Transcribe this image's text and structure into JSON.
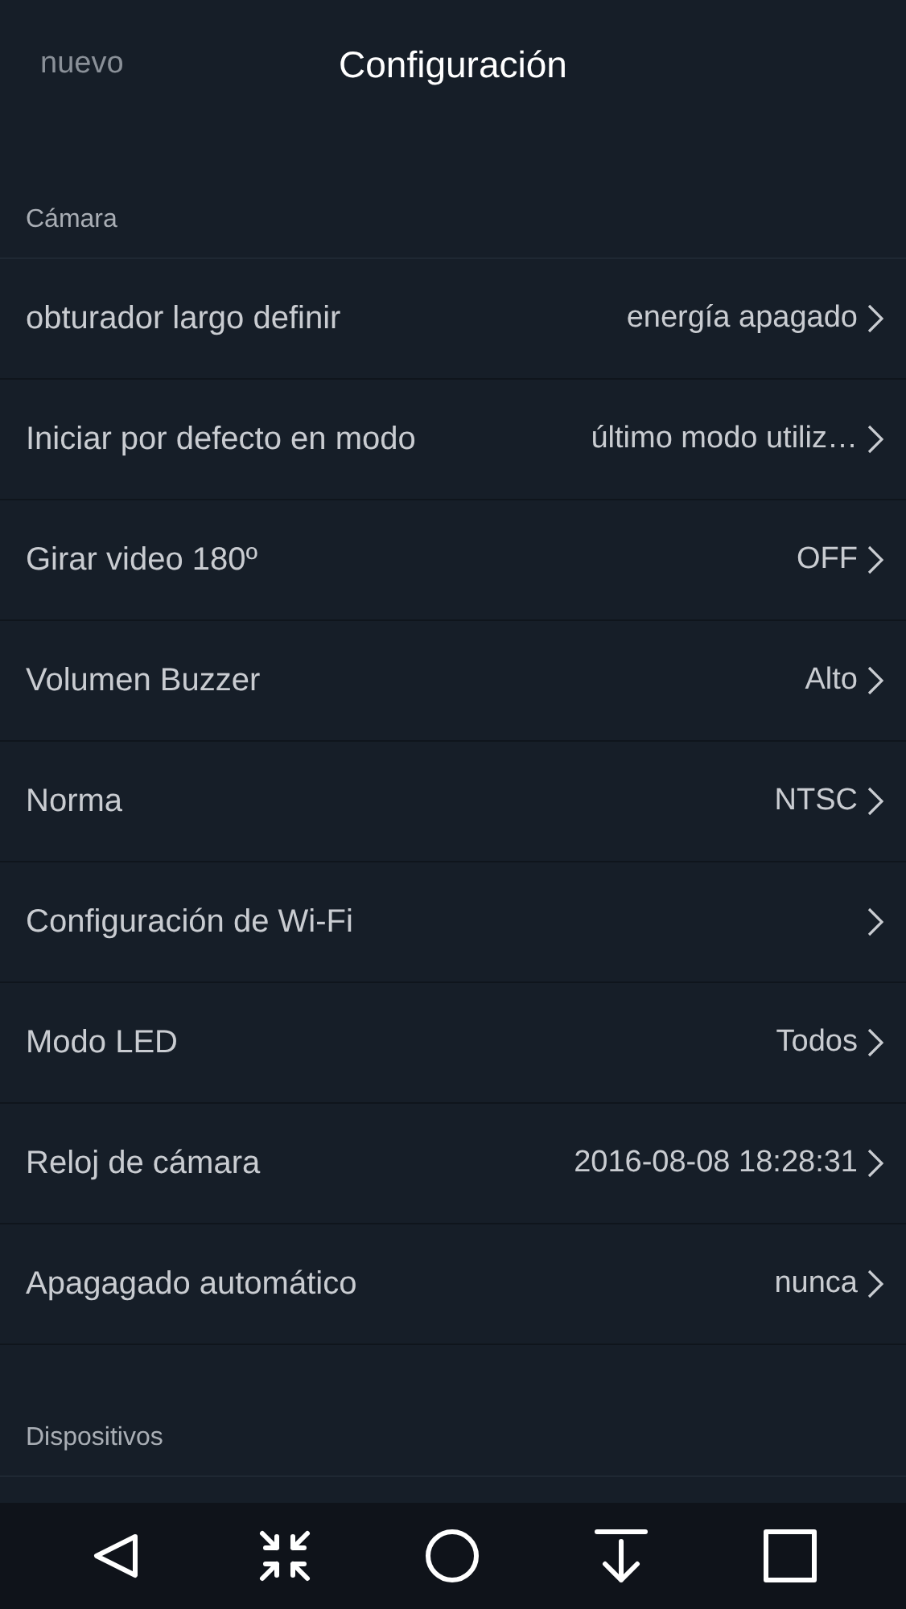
{
  "header": {
    "back": "nuevo",
    "title": "Configuración"
  },
  "sections": [
    {
      "title": "Cámara",
      "rows": [
        {
          "label": "obturador largo definir",
          "value": "energía apagado"
        },
        {
          "label": "Iniciar por defecto en modo",
          "value": "último modo utiliz…"
        },
        {
          "label": "Girar video 180º",
          "value": "OFF"
        },
        {
          "label": "Volumen Buzzer",
          "value": "Alto"
        },
        {
          "label": "Norma",
          "value": "NTSC"
        },
        {
          "label": "Configuración de Wi-Fi"
        },
        {
          "label": "Modo LED",
          "value": "Todos"
        },
        {
          "label": "Reloj de cámara",
          "value": "2016-08-08 18:28:31"
        },
        {
          "label": "Apagagado automático",
          "value": "nunca"
        }
      ]
    },
    {
      "title": "Dispositivos"
    }
  ],
  "nav": [
    {
      "kind": "back"
    },
    {
      "kind": "compress"
    },
    {
      "kind": "home"
    },
    {
      "kind": "download"
    },
    {
      "kind": "recents"
    }
  ]
}
